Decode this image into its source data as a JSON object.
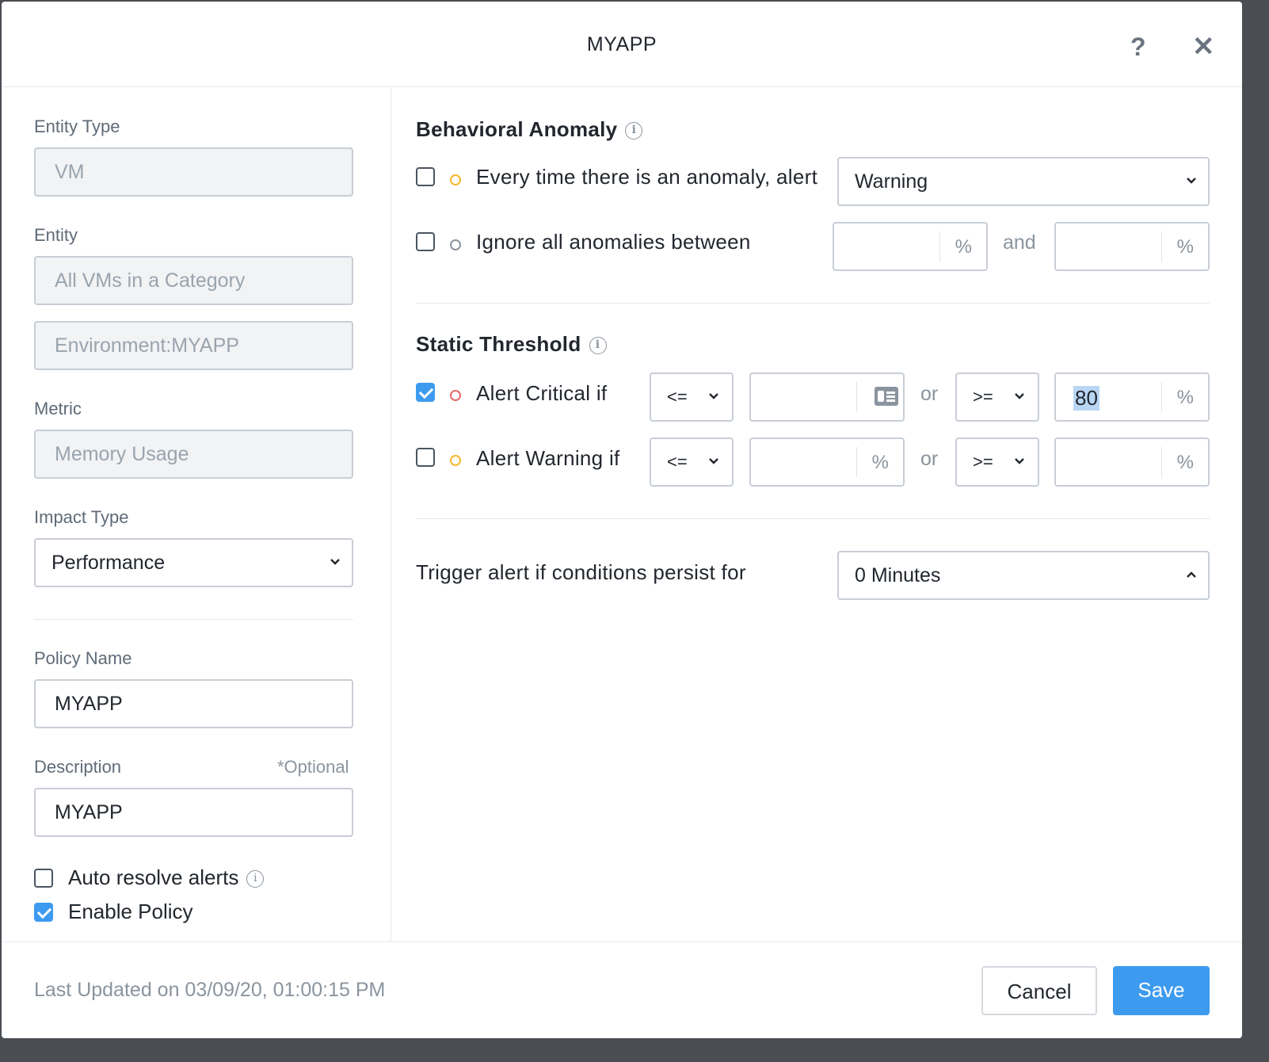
{
  "header": {
    "title": "MYAPP",
    "help_icon": "question-mark-icon",
    "close_icon": "close-icon"
  },
  "left": {
    "entity_type_label": "Entity Type",
    "entity_type_value": "VM",
    "entity_label": "Entity",
    "entity_value": "All VMs in a Category",
    "category_value": "Environment:MYAPP",
    "metric_label": "Metric",
    "metric_value": "Memory Usage",
    "impact_type_label": "Impact Type",
    "impact_type_value": "Performance",
    "policy_name_label": "Policy Name",
    "policy_name_value": "MYAPP",
    "description_label": "Description",
    "description_optional": "*Optional",
    "description_value": "MYAPP",
    "auto_resolve_label": "Auto resolve alerts",
    "enable_policy_label": "Enable Policy"
  },
  "behavioral": {
    "title": "Behavioral Anomaly",
    "every_time_label": "Every time there is an anomaly, alert",
    "every_time_severity": "Warning",
    "ignore_label": "Ignore all anomalies between",
    "ignore_and": "and",
    "unit": "%"
  },
  "static": {
    "title": "Static Threshold",
    "critical_label": "Alert Critical if",
    "warning_label": "Alert Warning if",
    "op_lte": "<=",
    "op_gte": ">=",
    "or": "or",
    "unit": "%",
    "critical_upper_value": "80"
  },
  "trigger": {
    "label": "Trigger alert if conditions persist for",
    "value": "0 Minutes"
  },
  "footer": {
    "last_updated": "Last Updated on 03/09/20, 01:00:15 PM",
    "cancel_label": "Cancel",
    "save_label": "Save"
  },
  "colors": {
    "accent": "#3d9bef",
    "critical": "#e56a6a",
    "warning": "#f5b82e"
  }
}
